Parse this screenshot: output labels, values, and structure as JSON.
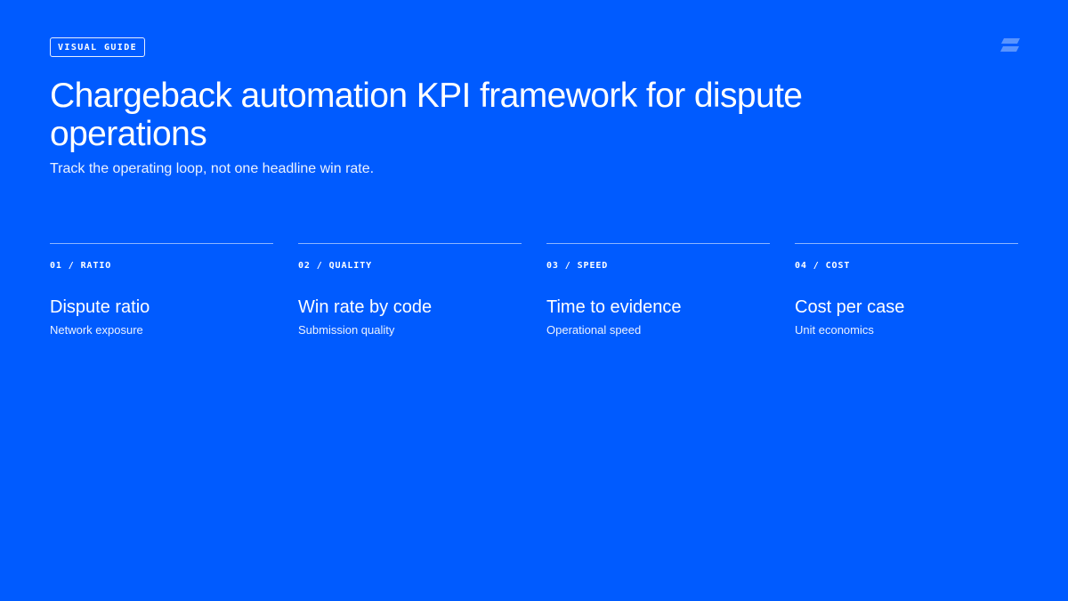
{
  "tag": "VISUAL GUIDE",
  "title": "Chargeback automation KPI framework for dispute operations",
  "subtitle": "Track the operating loop, not one headline win rate.",
  "logo_icon": "stacked-bars-logo-icon",
  "colors": {
    "background": "#005bff",
    "text": "#ffffff"
  },
  "kpis": [
    {
      "label": "01 / RATIO",
      "title": "Dispute ratio",
      "description": "Network exposure"
    },
    {
      "label": "02 / QUALITY",
      "title": "Win rate by code",
      "description": "Submission quality"
    },
    {
      "label": "03 / SPEED",
      "title": "Time to evidence",
      "description": "Operational speed"
    },
    {
      "label": "04 / COST",
      "title": "Cost per case",
      "description": "Unit economics"
    }
  ]
}
